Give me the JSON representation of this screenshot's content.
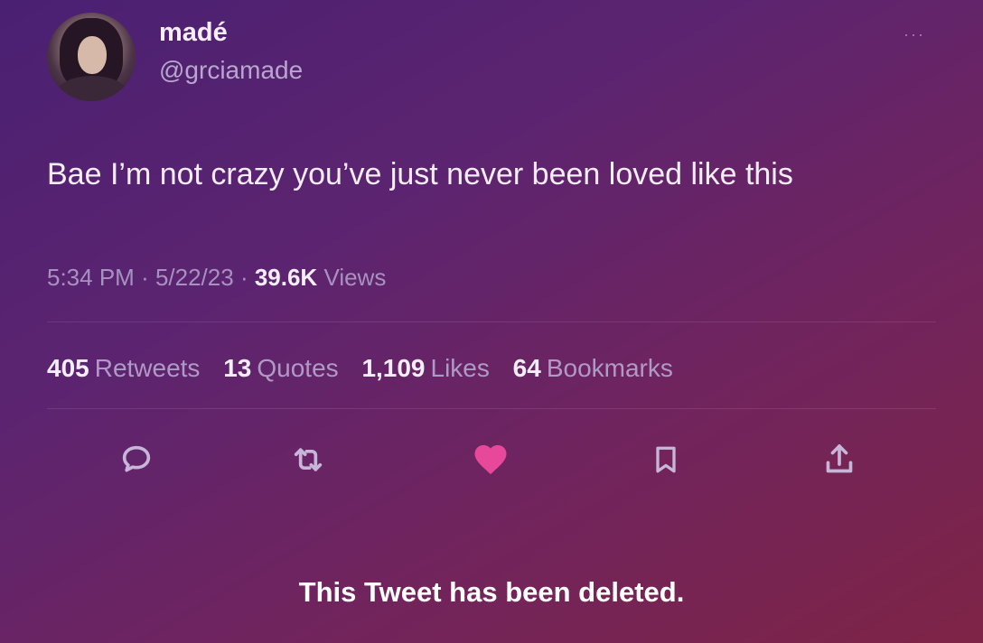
{
  "user": {
    "display_name": "madé",
    "handle": "@grciamade"
  },
  "more_icon": "···",
  "tweet": {
    "text": "Bae I’m not crazy you’ve just never been loved like this"
  },
  "meta": {
    "time": "5:34 PM",
    "date": "5/22/23",
    "views_count": "39.6K",
    "views_label": "Views"
  },
  "stats": {
    "retweets_count": "405",
    "retweets_label": "Retweets",
    "quotes_count": "13",
    "quotes_label": "Quotes",
    "likes_count": "1,109",
    "likes_label": "Likes",
    "bookmarks_count": "64",
    "bookmarks_label": "Bookmarks"
  },
  "actions": {
    "icons": [
      "reply-icon",
      "retweet-icon",
      "like-icon",
      "bookmark-icon",
      "share-icon"
    ],
    "like_color": "#e8489a",
    "icon_color": "#c7b6da"
  },
  "footer": {
    "deleted_notice": "This Tweet has been deleted."
  }
}
